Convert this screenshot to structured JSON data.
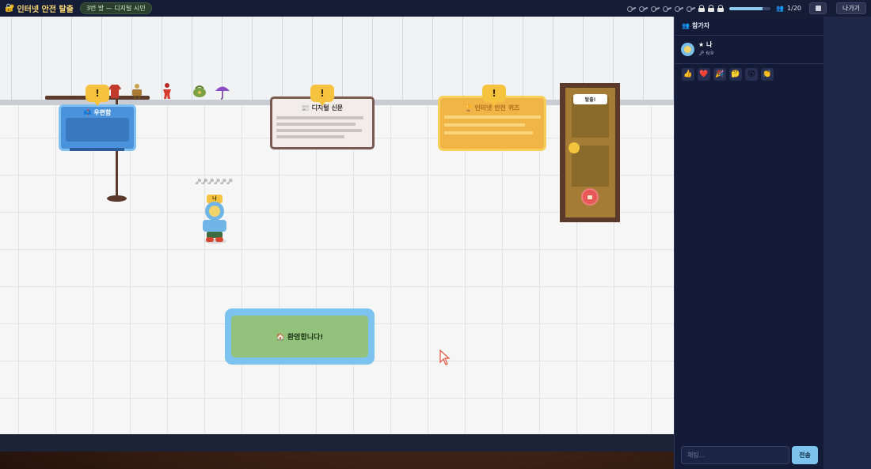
{
  "header": {
    "title": "인터넷 안전 탈출",
    "title_icon": "lock-key-icon",
    "room_badge": "3번 방 — 디지털 시민",
    "keys_total": 6,
    "locks_total": 3,
    "progress_fraction": 0.8,
    "player_count": "1/20",
    "menu_icon": "square-menu-icon",
    "exit_label": "나가기"
  },
  "scene": {
    "shelf_items": [
      "red-coat-icon",
      "mannequin-icon",
      "red-figure-icon",
      "green-bag-icon",
      "purple-umbrella-icon"
    ],
    "alert_mark": "!",
    "boards": {
      "post": {
        "label": "📫 우편함"
      },
      "news": {
        "label": "📰 디지털 신문"
      },
      "quiz": {
        "label": "🏆 인터넷 안전 퀴즈"
      }
    },
    "door": {
      "sign": "탈출!",
      "lock_icon": "padlock-icon"
    },
    "welcome": "🏠 환영합니다!",
    "player": {
      "keys": "🗝🗝🗝🗝🗝🗝",
      "name": "나"
    }
  },
  "sidebar": {
    "participants_title": "참가자",
    "participants_icon": "people-icon",
    "users": [
      {
        "name": "★ 나",
        "keys": "🗝 6/9"
      }
    ],
    "reactions": [
      "👍",
      "❤️",
      "🎉",
      "🤔",
      "😮",
      "👏"
    ],
    "chat_placeholder": "채팅...",
    "send_label": "전송"
  },
  "colors": {
    "topbar": "#151c35",
    "sidebar": "#141b37",
    "accent_yellow": "#f6c33e",
    "accent_blue": "#7cc4ef"
  }
}
